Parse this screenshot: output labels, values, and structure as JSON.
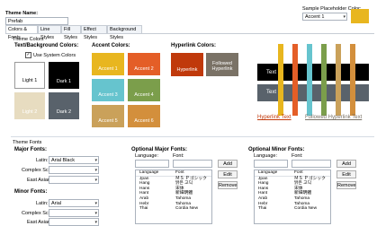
{
  "theme_name": {
    "label": "Theme Name:",
    "value": "Prefab"
  },
  "placeholder_color": {
    "label": "Sample Placeholder Color:",
    "value": "Accent 1",
    "color": "#e8b61f"
  },
  "tabs": [
    {
      "label": "Colors & Fonts"
    },
    {
      "label": "Line Styles"
    },
    {
      "label": "Fill Styles"
    },
    {
      "label": "Effect Styles"
    },
    {
      "label": "Background Styles"
    }
  ],
  "theme_colors": {
    "group_label": "Theme Colors",
    "text_bg_title": "Text/Background Colors:",
    "use_system_colors": "Use System Colors",
    "use_system_checked": true,
    "light1": {
      "label": "Light 1",
      "color": "#ffffff"
    },
    "dark1": {
      "label": "Dark 1",
      "color": "#000000"
    },
    "light2": {
      "label": "Light 2",
      "color": "#e7dcc0"
    },
    "dark2": {
      "label": "Dark 2",
      "color": "#59626b"
    },
    "accent_title": "Accent Colors:",
    "accents": [
      {
        "label": "Accent 1",
        "color": "#e8b61f"
      },
      {
        "label": "Accent 2",
        "color": "#e45e27"
      },
      {
        "label": "Accent 3",
        "color": "#66c4ce"
      },
      {
        "label": "Accent 4",
        "color": "#7b9e4b"
      },
      {
        "label": "Accent 5",
        "color": "#caa15a"
      },
      {
        "label": "Accent 6",
        "color": "#d38f3c"
      }
    ],
    "hyperlink_title": "Hyperlink Colors:",
    "hyperlink": {
      "label": "Hyperlink",
      "color": "#c0390b"
    },
    "followed": {
      "label": "Followed Hyperlink",
      "color": "#7a7266"
    }
  },
  "preview": {
    "text1": "Text",
    "text2": "Text",
    "hyperlink_text": "Hyperlink Text",
    "followed_text": "Followed Hyperlink Text"
  },
  "theme_fonts": {
    "group_label": "Theme Fonts",
    "major_title": "Major Fonts:",
    "minor_title": "Minor Fonts:",
    "latin_label": "Latin:",
    "complex_label": "Complex Script:",
    "east_asian_label": "East Asian:",
    "major_latin": "Arial Black",
    "major_complex": "",
    "major_east": "",
    "minor_latin": "Arial",
    "minor_complex": "",
    "minor_east": ""
  },
  "optional_major": {
    "title": "Optional Major Fonts:",
    "language_label": "Language:",
    "font_label": "Font:",
    "buttons": {
      "add": "Add",
      "edit": "Edit",
      "remove": "Remove"
    },
    "col_language": "Language",
    "col_font": "Font",
    "rows": [
      {
        "lang": "Jpan",
        "font": "ＭＳ Ｐゴシック"
      },
      {
        "lang": "Hang",
        "font": "맑은 고딕"
      },
      {
        "lang": "Hans",
        "font": "宋体"
      },
      {
        "lang": "Hant",
        "font": "新細明體"
      },
      {
        "lang": "Arab",
        "font": "Tahoma"
      },
      {
        "lang": "Hebr",
        "font": "Tahoma"
      },
      {
        "lang": "Thai",
        "font": "Cordia New"
      }
    ]
  },
  "optional_minor": {
    "title": "Optional Minor Fonts:",
    "language_label": "Language:",
    "font_label": "Font:",
    "buttons": {
      "add": "Add",
      "edit": "Edit",
      "remove": "Remove"
    },
    "col_language": "Language",
    "col_font": "Font",
    "rows": [
      {
        "lang": "Jpan",
        "font": "ＭＳ Ｐゴシック"
      },
      {
        "lang": "Hang",
        "font": "맑은 고딕"
      },
      {
        "lang": "Hans",
        "font": "宋体"
      },
      {
        "lang": "Hant",
        "font": "新細明體"
      },
      {
        "lang": "Arab",
        "font": "Tahoma"
      },
      {
        "lang": "Hebr",
        "font": "Tahoma"
      },
      {
        "lang": "Thai",
        "font": "Cordia New"
      }
    ]
  }
}
